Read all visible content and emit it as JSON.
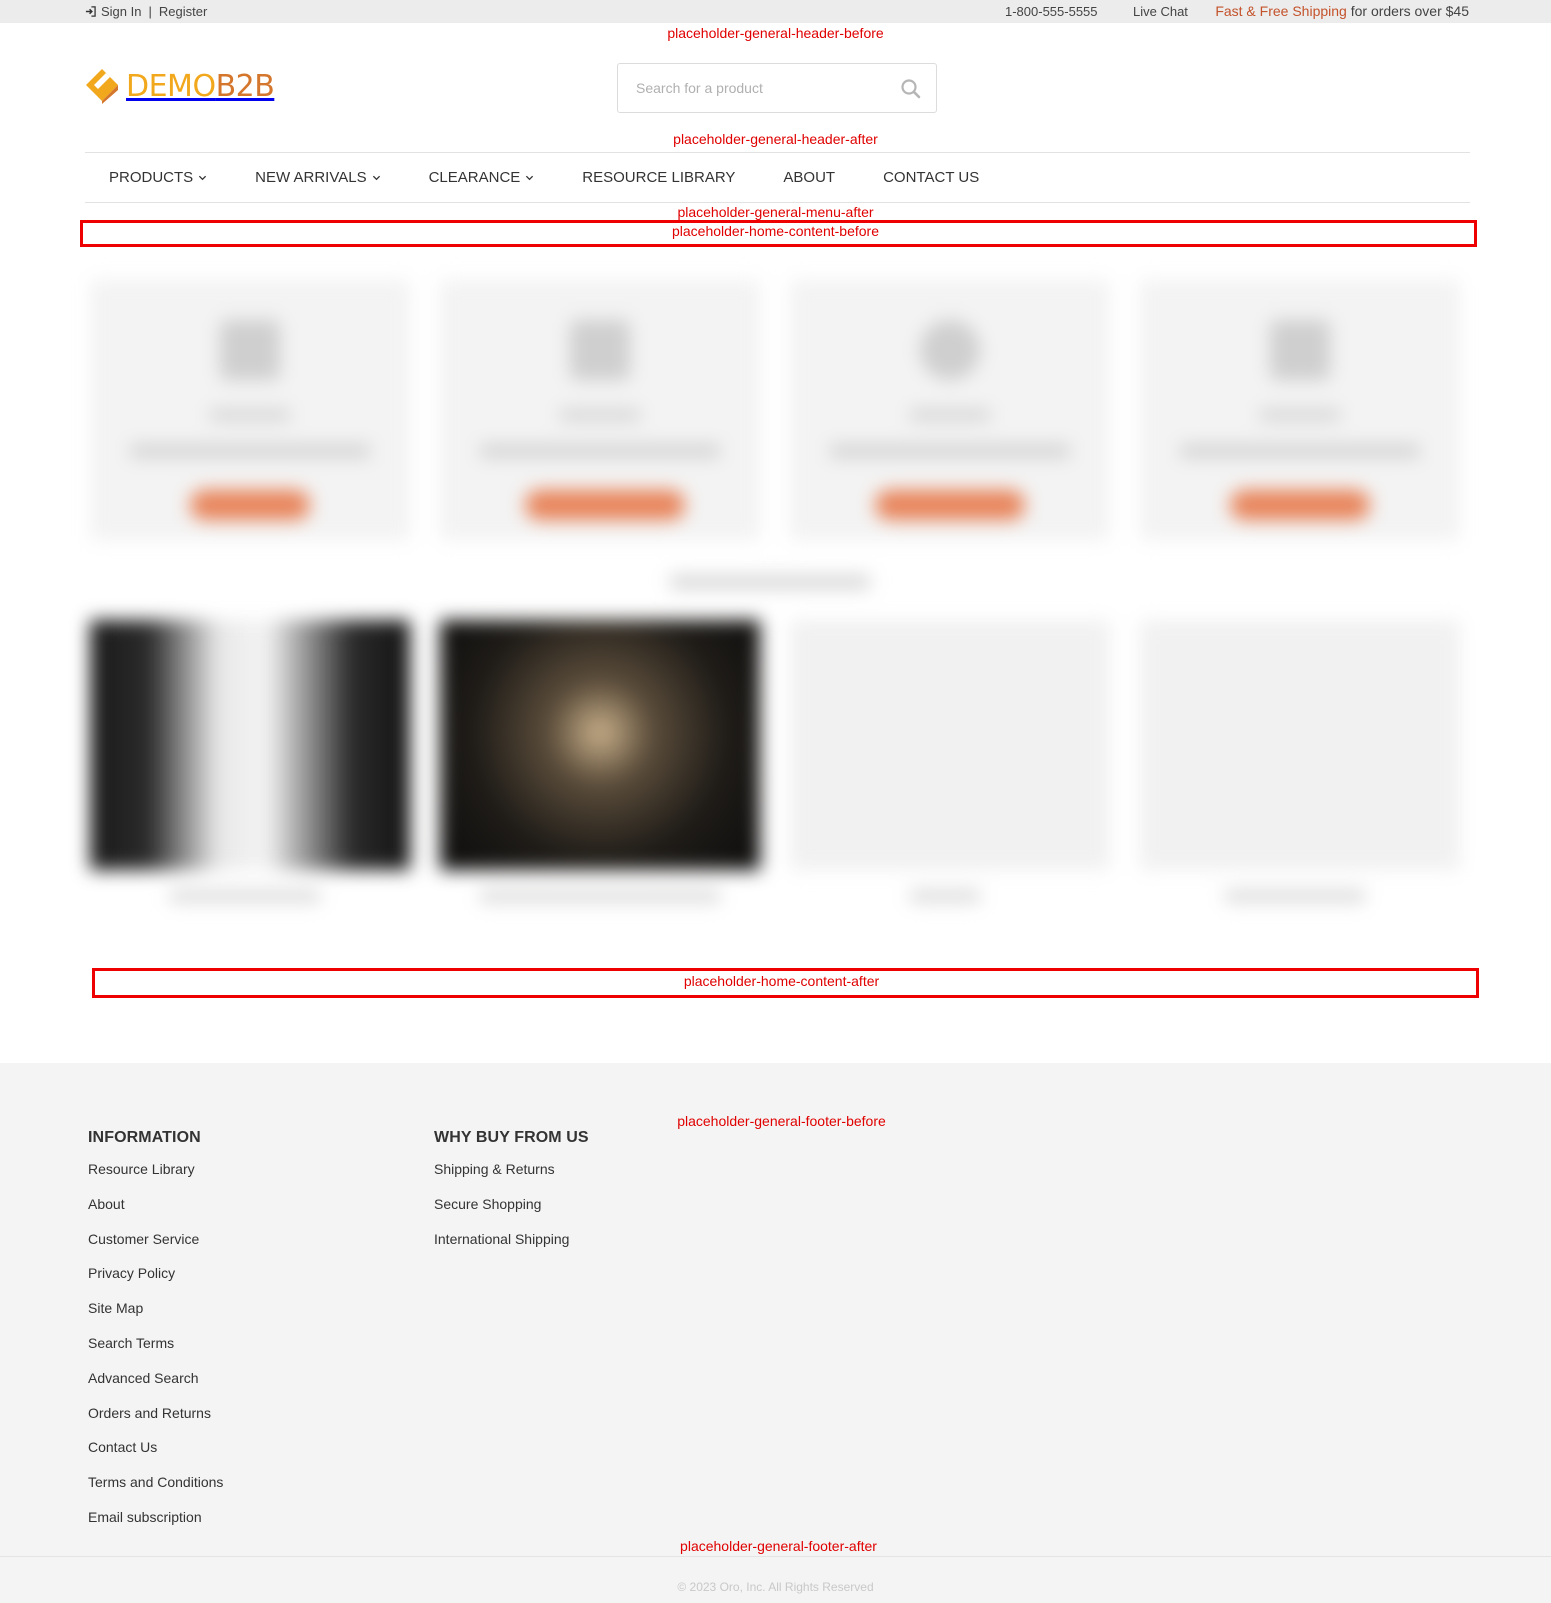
{
  "topbar": {
    "sign_in": "Sign In",
    "separator": "|",
    "register": "Register",
    "phone": "1-800-555-5555",
    "live_chat": "Live Chat",
    "shipping_accent": "Fast & Free Shipping",
    "shipping_rest": " for orders over $45"
  },
  "placeholders": {
    "header_before": "placeholder-general-header-before",
    "header_after": "placeholder-general-header-after",
    "menu_after": "placeholder-general-menu-after",
    "home_content_before": "placeholder-home-content-before",
    "home_content_after": "placeholder-home-content-after",
    "footer_before": "placeholder-general-footer-before",
    "footer_after": "placeholder-general-footer-after"
  },
  "logo": {
    "part1": "DEMO",
    "part2": "B2B"
  },
  "search": {
    "placeholder": "Search for a product"
  },
  "nav": {
    "items": [
      {
        "label": "PRODUCTS",
        "dropdown": true
      },
      {
        "label": "NEW ARRIVALS",
        "dropdown": true
      },
      {
        "label": "CLEARANCE",
        "dropdown": true
      },
      {
        "label": "RESOURCE LIBRARY",
        "dropdown": false
      },
      {
        "label": "ABOUT",
        "dropdown": false
      },
      {
        "label": "CONTACT US",
        "dropdown": false
      }
    ]
  },
  "footer": {
    "information": {
      "title": "INFORMATION",
      "links": [
        "Resource Library",
        "About",
        "Customer Service",
        "Privacy Policy",
        "Site Map",
        "Search Terms",
        "Advanced Search",
        "Orders and Returns",
        "Contact Us",
        "Terms and Conditions",
        "Email subscription"
      ]
    },
    "why_buy": {
      "title": "WHY BUY FROM US",
      "links": [
        "Shipping & Returns",
        "Secure Shopping",
        "International Shipping"
      ]
    },
    "copyright": "© 2023 Oro, Inc. All Rights Reserved"
  },
  "colors": {
    "accent": "#c4522a",
    "placeholder_red": "#e00000",
    "logo_yellow": "#f2a81d",
    "logo_orange": "#d4762c"
  }
}
